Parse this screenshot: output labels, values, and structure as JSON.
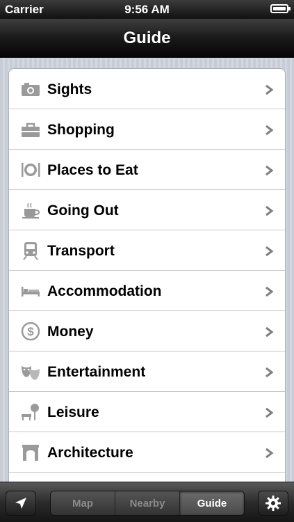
{
  "status_bar": {
    "carrier": "Carrier",
    "time": "9:56 AM"
  },
  "nav": {
    "title": "Guide"
  },
  "guide": {
    "items": [
      {
        "label": "Sights",
        "icon": "camera-icon"
      },
      {
        "label": "Shopping",
        "icon": "shopping-bag-icon"
      },
      {
        "label": "Places to Eat",
        "icon": "plate-cutlery-icon"
      },
      {
        "label": "Going Out",
        "icon": "coffee-cup-icon"
      },
      {
        "label": "Transport",
        "icon": "train-icon"
      },
      {
        "label": "Accommodation",
        "icon": "bed-icon"
      },
      {
        "label": "Money",
        "icon": "dollar-icon"
      },
      {
        "label": "Entertainment",
        "icon": "theater-masks-icon"
      },
      {
        "label": "Leisure",
        "icon": "park-bench-icon"
      },
      {
        "label": "Architecture",
        "icon": "arch-icon"
      }
    ]
  },
  "tabbar": {
    "segments": [
      "Map",
      "Nearby",
      "Guide"
    ],
    "active": "Guide"
  },
  "colors": {
    "icon_gray": "#9a9a9a",
    "chevron": "#7f7f7f"
  }
}
